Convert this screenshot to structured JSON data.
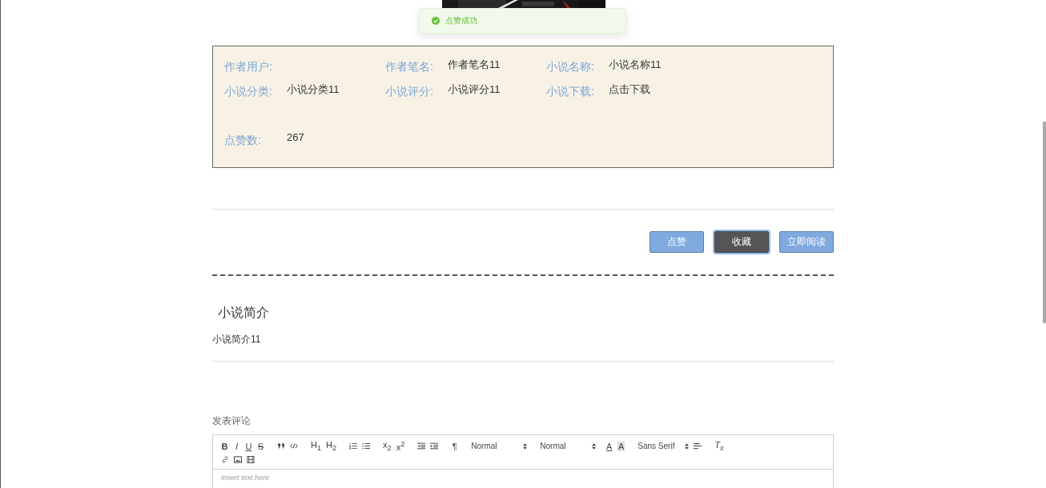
{
  "toast": {
    "message": "点赞成功"
  },
  "info": [
    {
      "label": "作者用户:"
    },
    {
      "label": "作者笔名:",
      "value": "作者笔名11"
    },
    {
      "label": "小说名称:",
      "value": "小说名称11"
    },
    {
      "label": "小说分类:",
      "value": "小说分类11"
    },
    {
      "label": "小说评分:",
      "value": "小说评分11"
    },
    {
      "label": "小说下载:",
      "value": "点击下载"
    },
    {
      "label": "点赞数:",
      "value": "267"
    }
  ],
  "buttons": [
    {
      "label": "点赞",
      "focused": false
    },
    {
      "label": "收藏",
      "focused": true
    },
    {
      "label": "立即阅读",
      "focused": false
    }
  ],
  "intro": {
    "title": "小说简介",
    "text": "小说简介11"
  },
  "comment": {
    "title": "发表评论",
    "placeholder": "Insert text here",
    "toolbar": {
      "bold": "B",
      "italic": "I",
      "underline": "U",
      "strike": "S",
      "h1": "H$_{1}$",
      "h2": "H$_{2}$",
      "sub": "x$_{2}$",
      "sup": "x$^{2}$",
      "direction": "¶",
      "size": "Normal",
      "header": "Normal",
      "fore": "A",
      "background": "A",
      "font": "Sans Serif",
      "clean": "T$_{x}$"
    }
  }
}
